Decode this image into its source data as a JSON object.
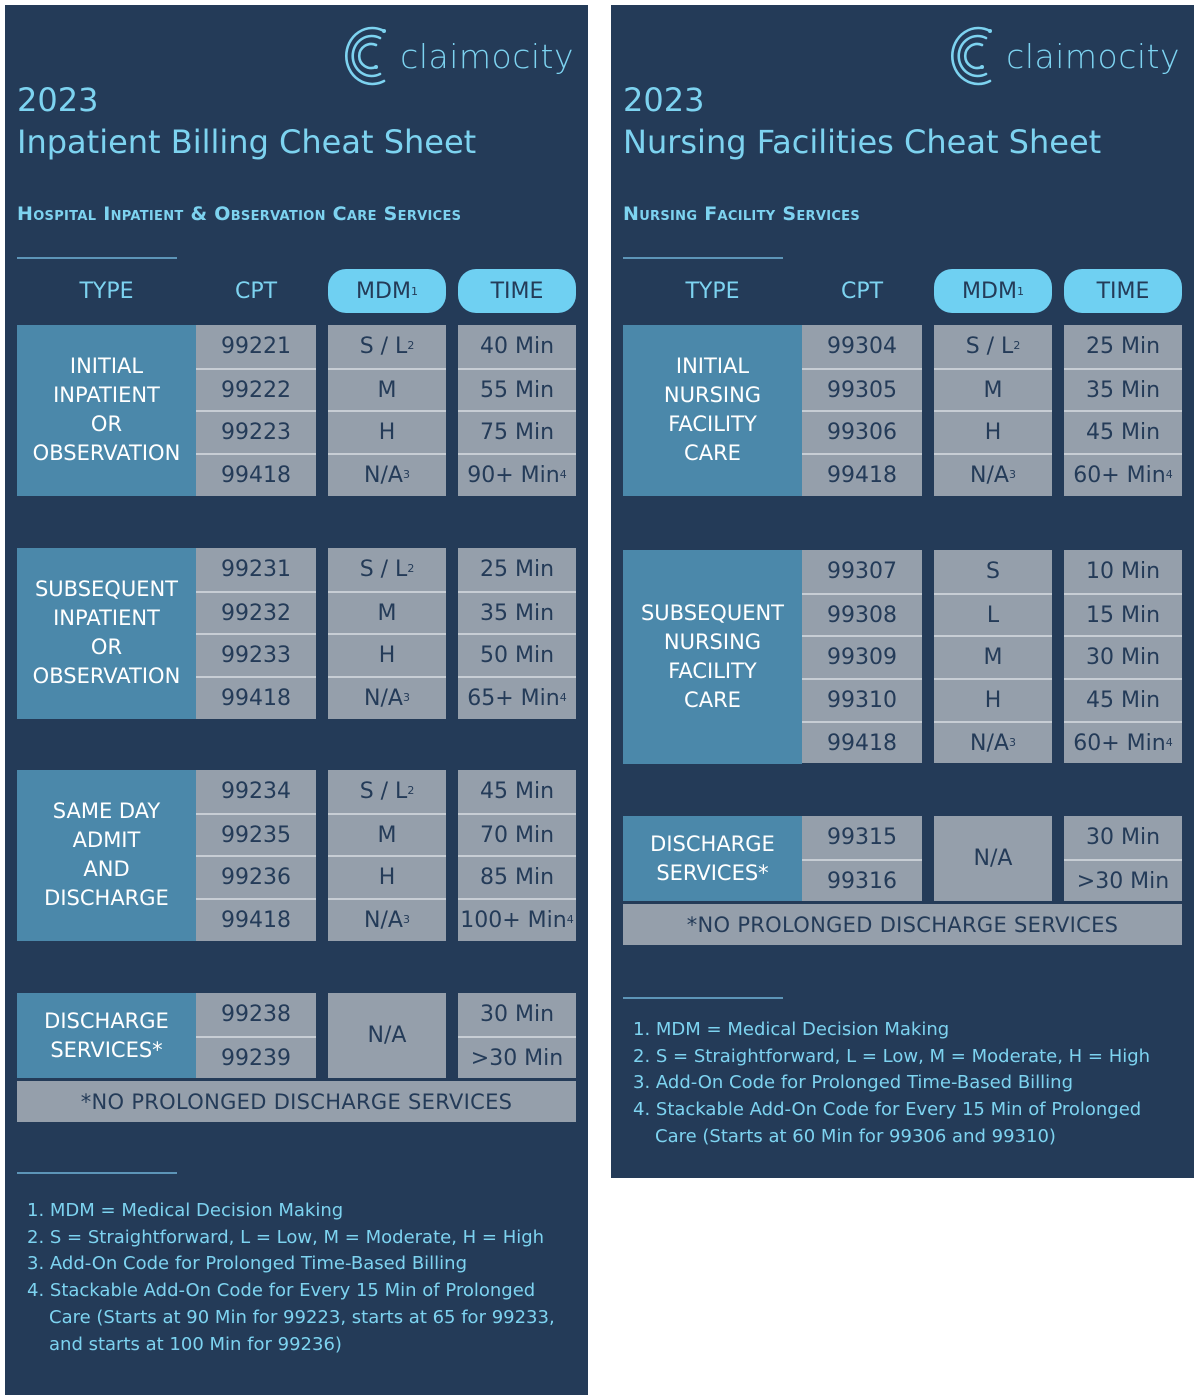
{
  "colors": {
    "panel_bg": "#243b58",
    "accent_text": "#7dd3f0",
    "pill_bg": "#6fd0f2",
    "type_cell_bg": "#4b88aa",
    "value_cell_bg": "#959fab"
  },
  "brand": {
    "logo_icon": "claimocity-c-arcs-icon",
    "name": "claimocity"
  },
  "sheets": [
    {
      "year": "2023",
      "title": "Inpatient Billing Cheat Sheet",
      "subtitle": "Hospital Inpatient & Observation Care Services",
      "headers": {
        "type": "TYPE",
        "cpt": "CPT",
        "mdm": "MDM",
        "mdm_sup": "1",
        "time": "TIME"
      },
      "sections": [
        {
          "type": "INITIAL\nINPATIENT\nOR\nOBSERVATION",
          "rows": [
            {
              "cpt": "99221",
              "mdm": "S / L",
              "mdm_sup": "2",
              "time": "40 Min",
              "time_sup": ""
            },
            {
              "cpt": "99222",
              "mdm": "M",
              "mdm_sup": "",
              "time": "55 Min",
              "time_sup": ""
            },
            {
              "cpt": "99223",
              "mdm": "H",
              "mdm_sup": "",
              "time": "75 Min",
              "time_sup": ""
            },
            {
              "cpt": "99418",
              "mdm": "N/A",
              "mdm_sup": "3",
              "time": "90+ Min",
              "time_sup": "4"
            }
          ]
        },
        {
          "type": "SUBSEQUENT\nINPATIENT\nOR\nOBSERVATION",
          "rows": [
            {
              "cpt": "99231",
              "mdm": "S / L",
              "mdm_sup": "2",
              "time": "25 Min",
              "time_sup": ""
            },
            {
              "cpt": "99232",
              "mdm": "M",
              "mdm_sup": "",
              "time": "35 Min",
              "time_sup": ""
            },
            {
              "cpt": "99233",
              "mdm": "H",
              "mdm_sup": "",
              "time": "50 Min",
              "time_sup": ""
            },
            {
              "cpt": "99418",
              "mdm": "N/A",
              "mdm_sup": "3",
              "time": "65+ Min",
              "time_sup": "4"
            }
          ]
        },
        {
          "type": "SAME DAY\nADMIT\nAND\nDISCHARGE",
          "rows": [
            {
              "cpt": "99234",
              "mdm": "S / L",
              "mdm_sup": "2",
              "time": "45 Min",
              "time_sup": ""
            },
            {
              "cpt": "99235",
              "mdm": "M",
              "mdm_sup": "",
              "time": "70 Min",
              "time_sup": ""
            },
            {
              "cpt": "99236",
              "mdm": "H",
              "mdm_sup": "",
              "time": "85 Min",
              "time_sup": ""
            },
            {
              "cpt": "99418",
              "mdm": "N/A",
              "mdm_sup": "3",
              "time": "100+ Min",
              "time_sup": "4"
            }
          ]
        }
      ],
      "discharge": {
        "type": "DISCHARGE\nSERVICES*",
        "cpts": [
          "99238",
          "99239"
        ],
        "mdm": "N/A",
        "times": [
          "30 Min",
          ">30 Min"
        ],
        "note": "*NO PROLONGED DISCHARGE SERVICES"
      },
      "footnotes": [
        "1. MDM = Medical Decision Making",
        "2. S = Straightforward, L = Low, M = Moderate, H = High",
        "3. Add-On Code for Prolonged Time-Based Billing",
        "4. Stackable Add-On Code for Every 15 Min of Prolonged Care (Starts at 90 Min for 99223, starts at 65 for 99233, and starts at 100 Min for 99236)"
      ]
    },
    {
      "year": "2023",
      "title": "Nursing Facilities Cheat Sheet",
      "subtitle": "Nursing Facility Services",
      "headers": {
        "type": "TYPE",
        "cpt": "CPT",
        "mdm": "MDM",
        "mdm_sup": "1",
        "time": "TIME"
      },
      "sections": [
        {
          "type": "INITIAL\nNURSING\nFACILITY\nCARE",
          "rows": [
            {
              "cpt": "99304",
              "mdm": "S / L",
              "mdm_sup": "2",
              "time": "25 Min",
              "time_sup": ""
            },
            {
              "cpt": "99305",
              "mdm": "M",
              "mdm_sup": "",
              "time": "35 Min",
              "time_sup": ""
            },
            {
              "cpt": "99306",
              "mdm": "H",
              "mdm_sup": "",
              "time": "45 Min",
              "time_sup": ""
            },
            {
              "cpt": "99418",
              "mdm": "N/A",
              "mdm_sup": "3",
              "time": "60+ Min",
              "time_sup": "4"
            }
          ]
        },
        {
          "type": "SUBSEQUENT\nNURSING\nFACILITY\nCARE",
          "rows": [
            {
              "cpt": "99307",
              "mdm": "S",
              "mdm_sup": "",
              "time": "10 Min",
              "time_sup": ""
            },
            {
              "cpt": "99308",
              "mdm": "L",
              "mdm_sup": "",
              "time": "15 Min",
              "time_sup": ""
            },
            {
              "cpt": "99309",
              "mdm": "M",
              "mdm_sup": "",
              "time": "30 Min",
              "time_sup": ""
            },
            {
              "cpt": "99310",
              "mdm": "H",
              "mdm_sup": "",
              "time": "45 Min",
              "time_sup": ""
            },
            {
              "cpt": "99418",
              "mdm": "N/A",
              "mdm_sup": "3",
              "time": "60+ Min",
              "time_sup": "4"
            }
          ]
        }
      ],
      "discharge": {
        "type": "DISCHARGE\nSERVICES*",
        "cpts": [
          "99315",
          "99316"
        ],
        "mdm": "N/A",
        "times": [
          "30 Min",
          ">30 Min"
        ],
        "note": "*NO PROLONGED DISCHARGE SERVICES"
      },
      "footnotes": [
        "1. MDM = Medical Decision Making",
        "2. S = Straightforward, L = Low, M = Moderate, H = High",
        "3. Add-On Code for Prolonged Time-Based Billing",
        "4. Stackable Add-On Code for Every 15 Min of Prolonged Care (Starts at 60 Min for 99306 and 99310)"
      ]
    }
  ]
}
